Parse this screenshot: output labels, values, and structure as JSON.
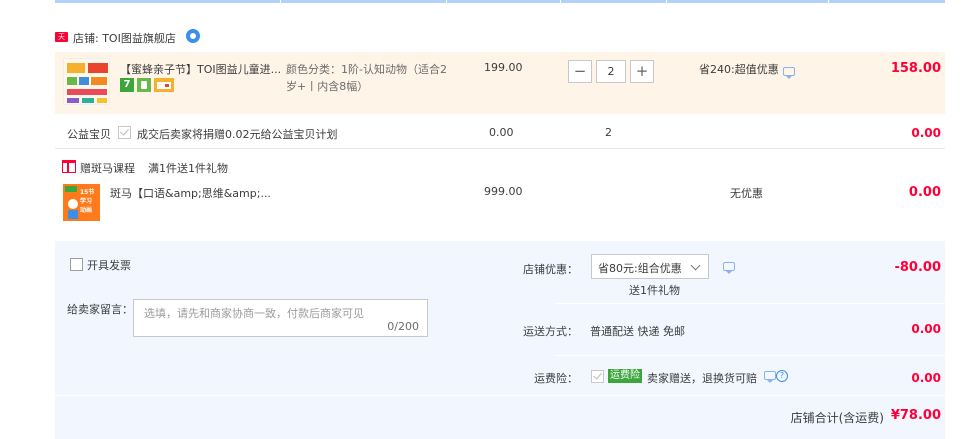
{
  "shop": {
    "badge": "天猫",
    "label": "店铺: TOI图益旗舰店"
  },
  "item1": {
    "title": "【蜜蜂亲子节】TOI图益儿童进...",
    "icon_7": "7",
    "sku_line1": "颜色分类：1阶-认知动物（适合2",
    "sku_line2": "岁+丨内含8幅）",
    "unit_price": "199.00",
    "qty_minus": "−",
    "qty_plus": "+",
    "qty": "2",
    "discount": "省240:超值优惠",
    "subtotal": "158.00"
  },
  "charity": {
    "label": "公益宝贝",
    "text": "成交后卖家将捐赠0.02元给公益宝贝计划",
    "price": "0.00",
    "qty": "2",
    "subtotal": "0.00"
  },
  "gift": {
    "label": "赠斑马课程",
    "desc": "满1件送1件礼物",
    "title": "斑马【口语&amp;思维&amp;...",
    "thumb_text": "15节 学习 动画",
    "price": "999.00",
    "discount": "无优惠",
    "subtotal": "0.00"
  },
  "invoice": {
    "label": "开具发票"
  },
  "message": {
    "label": "给卖家留言：",
    "placeholder": "选填，请先和商家协商一致，付款后商家可见",
    "count": "0/200"
  },
  "shop_discount": {
    "label": "店铺优惠：",
    "selected": "省80元:组合优惠",
    "sub": "送1件礼物",
    "amount": "-80.00"
  },
  "shipping": {
    "label": "运送方式：",
    "value": "普通配送 快递 免邮",
    "amount": "0.00"
  },
  "insurance": {
    "label": "运费险：",
    "tag": "运费险",
    "text": "卖家赠送，退换货可赔",
    "q": "?",
    "amount": "0.00"
  },
  "total": {
    "label": "店铺合计(含运费)",
    "amount": "¥78.00"
  },
  "colors": {
    "accent_red": "#ff0036",
    "header_blue": "#b2d1ff",
    "item_bg": "#fff4e8",
    "lower_bg": "#f2f7ff"
  }
}
